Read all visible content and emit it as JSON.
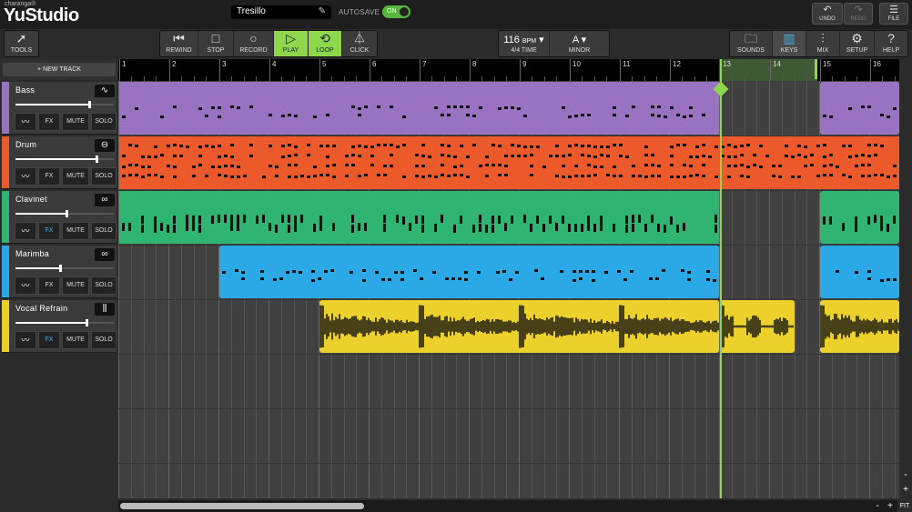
{
  "header": {
    "brand_small": "charanga®",
    "brand": "YuStudio",
    "project_name": "Tresillo",
    "autosave_label": "AUTOSAVE",
    "autosave_state": "ON",
    "undo": "UNDO",
    "redo": "REDO",
    "file": "FILE"
  },
  "toolbar": {
    "tools": "TOOLS",
    "rewind": "REWIND",
    "stop": "STOP",
    "record": "RECORD",
    "play": "PLAY",
    "loop": "LOOP",
    "click": "CLICK",
    "bpm_value": "116",
    "bpm_unit": "BPM",
    "time_sig": "4/4 TIME",
    "key": "A",
    "mode": "MINOR",
    "sounds": "SOUNDS",
    "keys": "KEYS",
    "mix": "MIX",
    "setup": "SETUP",
    "help": "HELP"
  },
  "new_track": "+ NEW TRACK",
  "ruler": {
    "bars": [
      "1",
      "2",
      "3",
      "4",
      "5",
      "6",
      "7",
      "8",
      "9",
      "10",
      "11",
      "12",
      "13",
      "14",
      "15",
      "16"
    ]
  },
  "tracks": [
    {
      "name": "Bass",
      "color": "#9a72c2",
      "icon": "wave-icon",
      "fx": "FX",
      "mute": "MUTE",
      "solo": "SOLO",
      "volume": 0.75,
      "fx_active": false
    },
    {
      "name": "Drum",
      "color": "#ec5a2c",
      "icon": "drum-icon",
      "fx": "FX",
      "mute": "MUTE",
      "solo": "SOLO",
      "volume": 0.82,
      "fx_active": false
    },
    {
      "name": "Clavinet",
      "color": "#2fb571",
      "icon": "loop-icon",
      "fx": "FX",
      "mute": "MUTE",
      "solo": "SOLO",
      "volume": 0.52,
      "fx_active": true
    },
    {
      "name": "Marimba",
      "color": "#2aa9e6",
      "icon": "loop-icon",
      "fx": "FX",
      "mute": "MUTE",
      "solo": "SOLO",
      "volume": 0.45,
      "fx_active": false
    },
    {
      "name": "Vocal Refrain",
      "color": "#ecd12c",
      "icon": "audio-icon",
      "fx": "FX",
      "mute": "MUTE",
      "solo": "SOLO",
      "volume": 0.72,
      "fx_active": true
    }
  ],
  "zoom": {
    "minus": "-",
    "plus": "+",
    "fit": "FIT"
  }
}
